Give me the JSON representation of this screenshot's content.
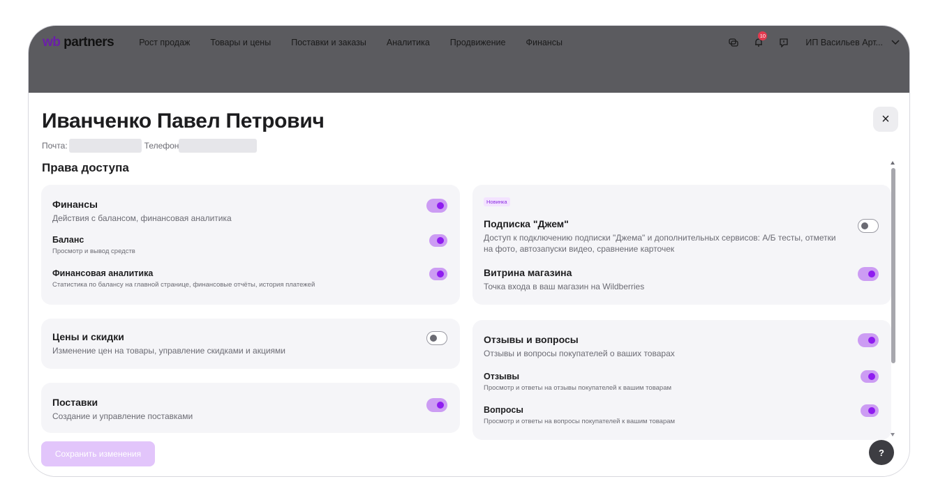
{
  "nav": {
    "logo_prefix": "wb",
    "logo_rest": " partners",
    "items": [
      "Рост продаж",
      "Товары и цены",
      "Поставки и заказы",
      "Аналитика",
      "Продвижение",
      "Финансы"
    ],
    "notification_count": "10",
    "user_name": "ИП Васильев Арт..."
  },
  "modal": {
    "title": "Иванченко Павел Петрович",
    "email_label": "Почта:",
    "phone_label": "Телефон",
    "section_title": "Права доступа",
    "save_label": "Сохранить изменения",
    "help_label": "?",
    "close_label": "×"
  },
  "cards": {
    "finance": {
      "title": "Финансы",
      "desc": "Действия с балансом, финансовая аналитика",
      "on": true,
      "balance": {
        "title": "Баланс",
        "desc": "Просмотр и вывод средств",
        "on": true
      },
      "analytics": {
        "title": "Финансовая аналитика",
        "desc": "Статистика по балансу на главной странице, финансовые отчёты, история платежей",
        "on": true
      }
    },
    "prices": {
      "title": "Цены и скидки",
      "desc": "Изменение цен на товары, управление скидками и акциями",
      "on": false
    },
    "supplies": {
      "title": "Поставки",
      "desc": "Создание и управление поставками",
      "on": true
    },
    "subscription": {
      "badge": "Новинка",
      "title": "Подписка \"Джем\"",
      "desc": "Доступ к подключению подписки \"Джема\" и дополнительных сервисов: А/Б тесты, отметки на фото, автозапуски видео, сравнение карточек",
      "on": false,
      "storefront": {
        "title": "Витрина магазина",
        "desc": "Точка входа в ваш магазин на Wildberries",
        "on": true
      }
    },
    "reviews": {
      "title": "Отзывы и вопросы",
      "desc": "Отзывы и вопросы покупателей о ваших товарах",
      "on": true,
      "feedback": {
        "title": "Отзывы",
        "desc": "Просмотр и ответы на отзывы покупателей к вашим товарам",
        "on": true
      },
      "questions": {
        "title": "Вопросы",
        "desc": "Просмотр и ответы на вопросы покупателей к вашим товарам",
        "on": true
      }
    }
  },
  "colors": {
    "accent": "#8f1cf0",
    "toggle_on_track": "#cc9cf3",
    "header_dim": "#5b5b5f",
    "card_bg": "#f5f5f8"
  }
}
